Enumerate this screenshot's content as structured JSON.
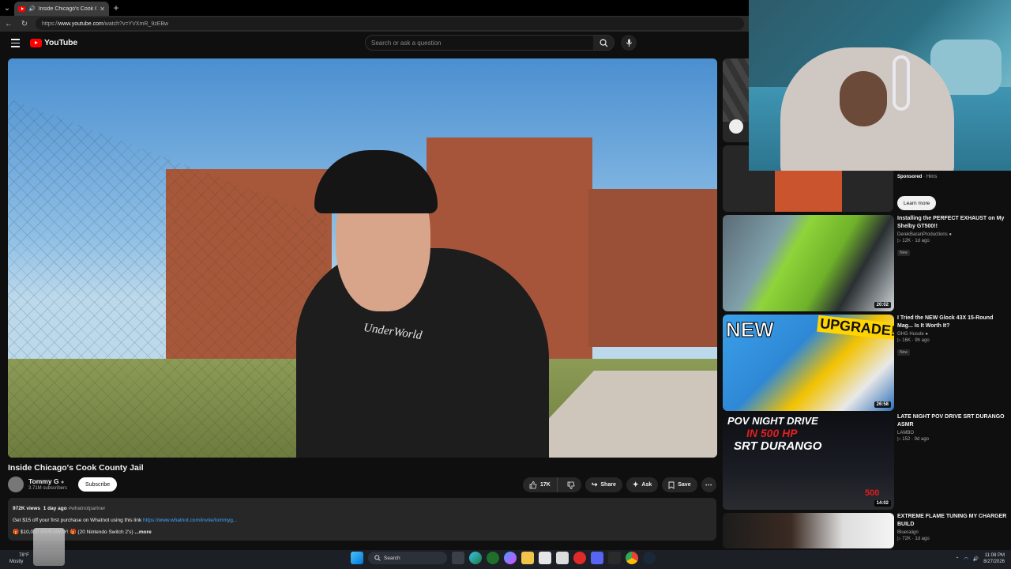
{
  "browser": {
    "tab_title": "Inside Chicago's Cook County J…",
    "url_prefix": "https://",
    "url_domain": "www.youtube.com",
    "url_path": "/watch?v=YVXmR_9zEBw"
  },
  "masthead": {
    "logo_text": "YouTube",
    "search_placeholder": "Search or ask a question"
  },
  "video": {
    "shirt_text": "UnderWorld",
    "title": "Inside Chicago's Cook County Jail",
    "channel_name": "Tommy G",
    "channel_subs": "3.71M subscribers",
    "subscribe_label": "Subscribe",
    "likes": "17K",
    "share_label": "Share",
    "ask_label": "Ask",
    "save_label": "Save"
  },
  "description": {
    "views": "972K views",
    "age": "1 day ago",
    "hashtag": "#whatnotpartner",
    "line2_text": "Get $15 off your first purchase on Whatnot using this link",
    "line2_link": "https://www.whatnot.com/invite/tommyg...",
    "line3_text": "🎁 $10,000 GIVEAWAY! 🎁 (20 Nintendo Switch 2's)",
    "more_label": "...more"
  },
  "sidebar": {
    "ad_sponsored": "Sponsored",
    "ad_brand": "Hims",
    "learn_more": "Learn more",
    "items": [
      {
        "title": "Installing the PERFECT EXHAUST on My Shelby GT500!!",
        "channel": "DerekBaranProductions",
        "views": "12K",
        "age": "1d ago",
        "badge": "New",
        "duration": "20:02"
      },
      {
        "title": "I Tried the NEW Glock 43X 15-Round Mag... Is It Worth It?",
        "channel": "GHG Hussle",
        "views": "16K",
        "age": "9h ago",
        "badge": "New",
        "duration": "26:58"
      },
      {
        "title": "LATE NIGHT POV DRIVE SRT DURANGO ASMR",
        "channel": "LAMBO",
        "views": "152",
        "age": "9d ago",
        "badge": "",
        "duration": "14:02"
      },
      {
        "title": "EXTREME FLAME TUNING MY CHARGER BUILD",
        "channel": "Blueraiign",
        "views": "72K",
        "age": "1d ago",
        "badge": "",
        "duration": ""
      }
    ],
    "thumb_text_1": "NEW",
    "thumb_text_2": "UPGRADE!",
    "thumb_text_3a": "POV NIGHT DRIVE",
    "thumb_text_3b": "IN 500 HP",
    "thumb_text_3c": "SRT DURANGO",
    "thumb_text_3d": "500"
  },
  "taskbar": {
    "weather_temp": "78°F",
    "weather_desc": "Mostly",
    "search_label": "Search",
    "time": "11:08 PM",
    "date": "8/27/2026"
  }
}
